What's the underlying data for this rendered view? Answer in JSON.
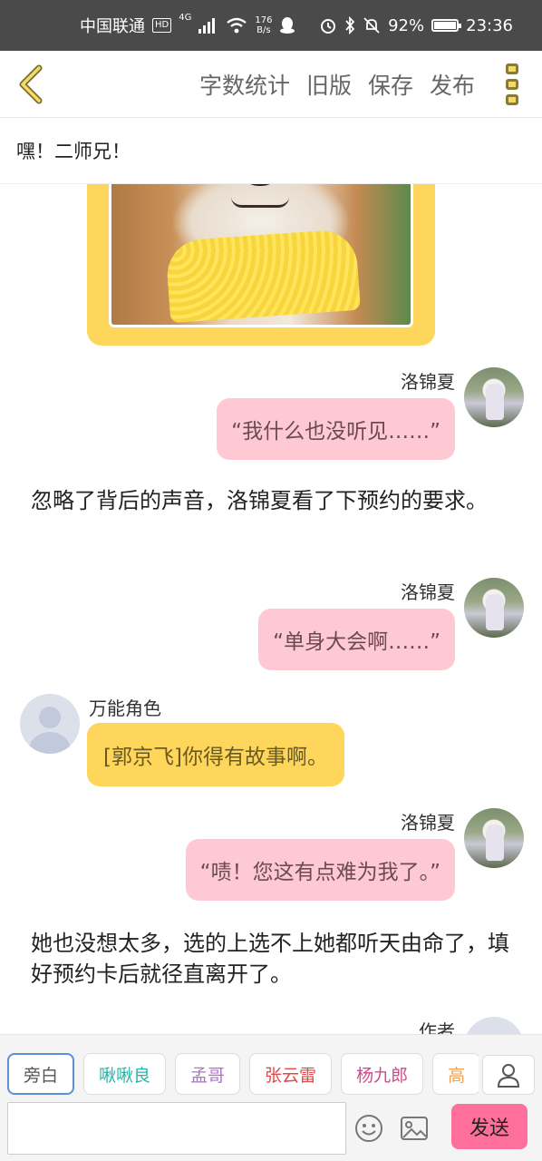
{
  "status_bar": {
    "carrier": "中国联通",
    "hd": "HD",
    "network": "4G",
    "speed_value": "176",
    "speed_unit": "B/s",
    "battery": "92%",
    "battery_level": 0.92,
    "time": "23:36"
  },
  "toolbar": {
    "back_icon": "back-chevron-icon",
    "actions": [
      "字数统计",
      "旧版",
      "保存",
      "发布"
    ],
    "more_icon": "more-vertical-icon",
    "accent": "#f4d96b"
  },
  "title": "嘿！二师兄！",
  "messages": [
    {
      "type": "right",
      "name": "洛锦夏",
      "text": "“我什么也没听见……”"
    },
    {
      "type": "narration",
      "text": "忽略了背后的声音，洛锦夏看了下预约的要求。"
    },
    {
      "type": "right",
      "name": "洛锦夏",
      "text": "“单身大会啊……”"
    },
    {
      "type": "left",
      "name": "万能角色",
      "text": "[郭京飞]你得有故事啊。"
    },
    {
      "type": "right",
      "name": "洛锦夏",
      "text": "“啧！您这有点难为我了。”"
    },
    {
      "type": "narration",
      "text": "她也没想太多，选的上选不上她都听天由命了，填好预约卡后就径直离开了。"
    },
    {
      "type": "right",
      "name": "作者",
      "text": ""
    }
  ],
  "roles": [
    {
      "label": "旁白",
      "color": "#555555"
    },
    {
      "label": "啾啾良",
      "color": "#2bb5a8"
    },
    {
      "label": "孟哥",
      "color": "#b26fd0"
    },
    {
      "label": "张云雷",
      "color": "#e04a4a"
    },
    {
      "label": "杨九郎",
      "color": "#d04a8c"
    },
    {
      "label": "高",
      "color": "#f0a050"
    }
  ],
  "input": {
    "placeholder": ""
  },
  "send_label": "发送",
  "colors": {
    "bubble_right": "#ffc9d3",
    "bubble_left": "#ffd65c",
    "send": "#ff6f9c"
  }
}
